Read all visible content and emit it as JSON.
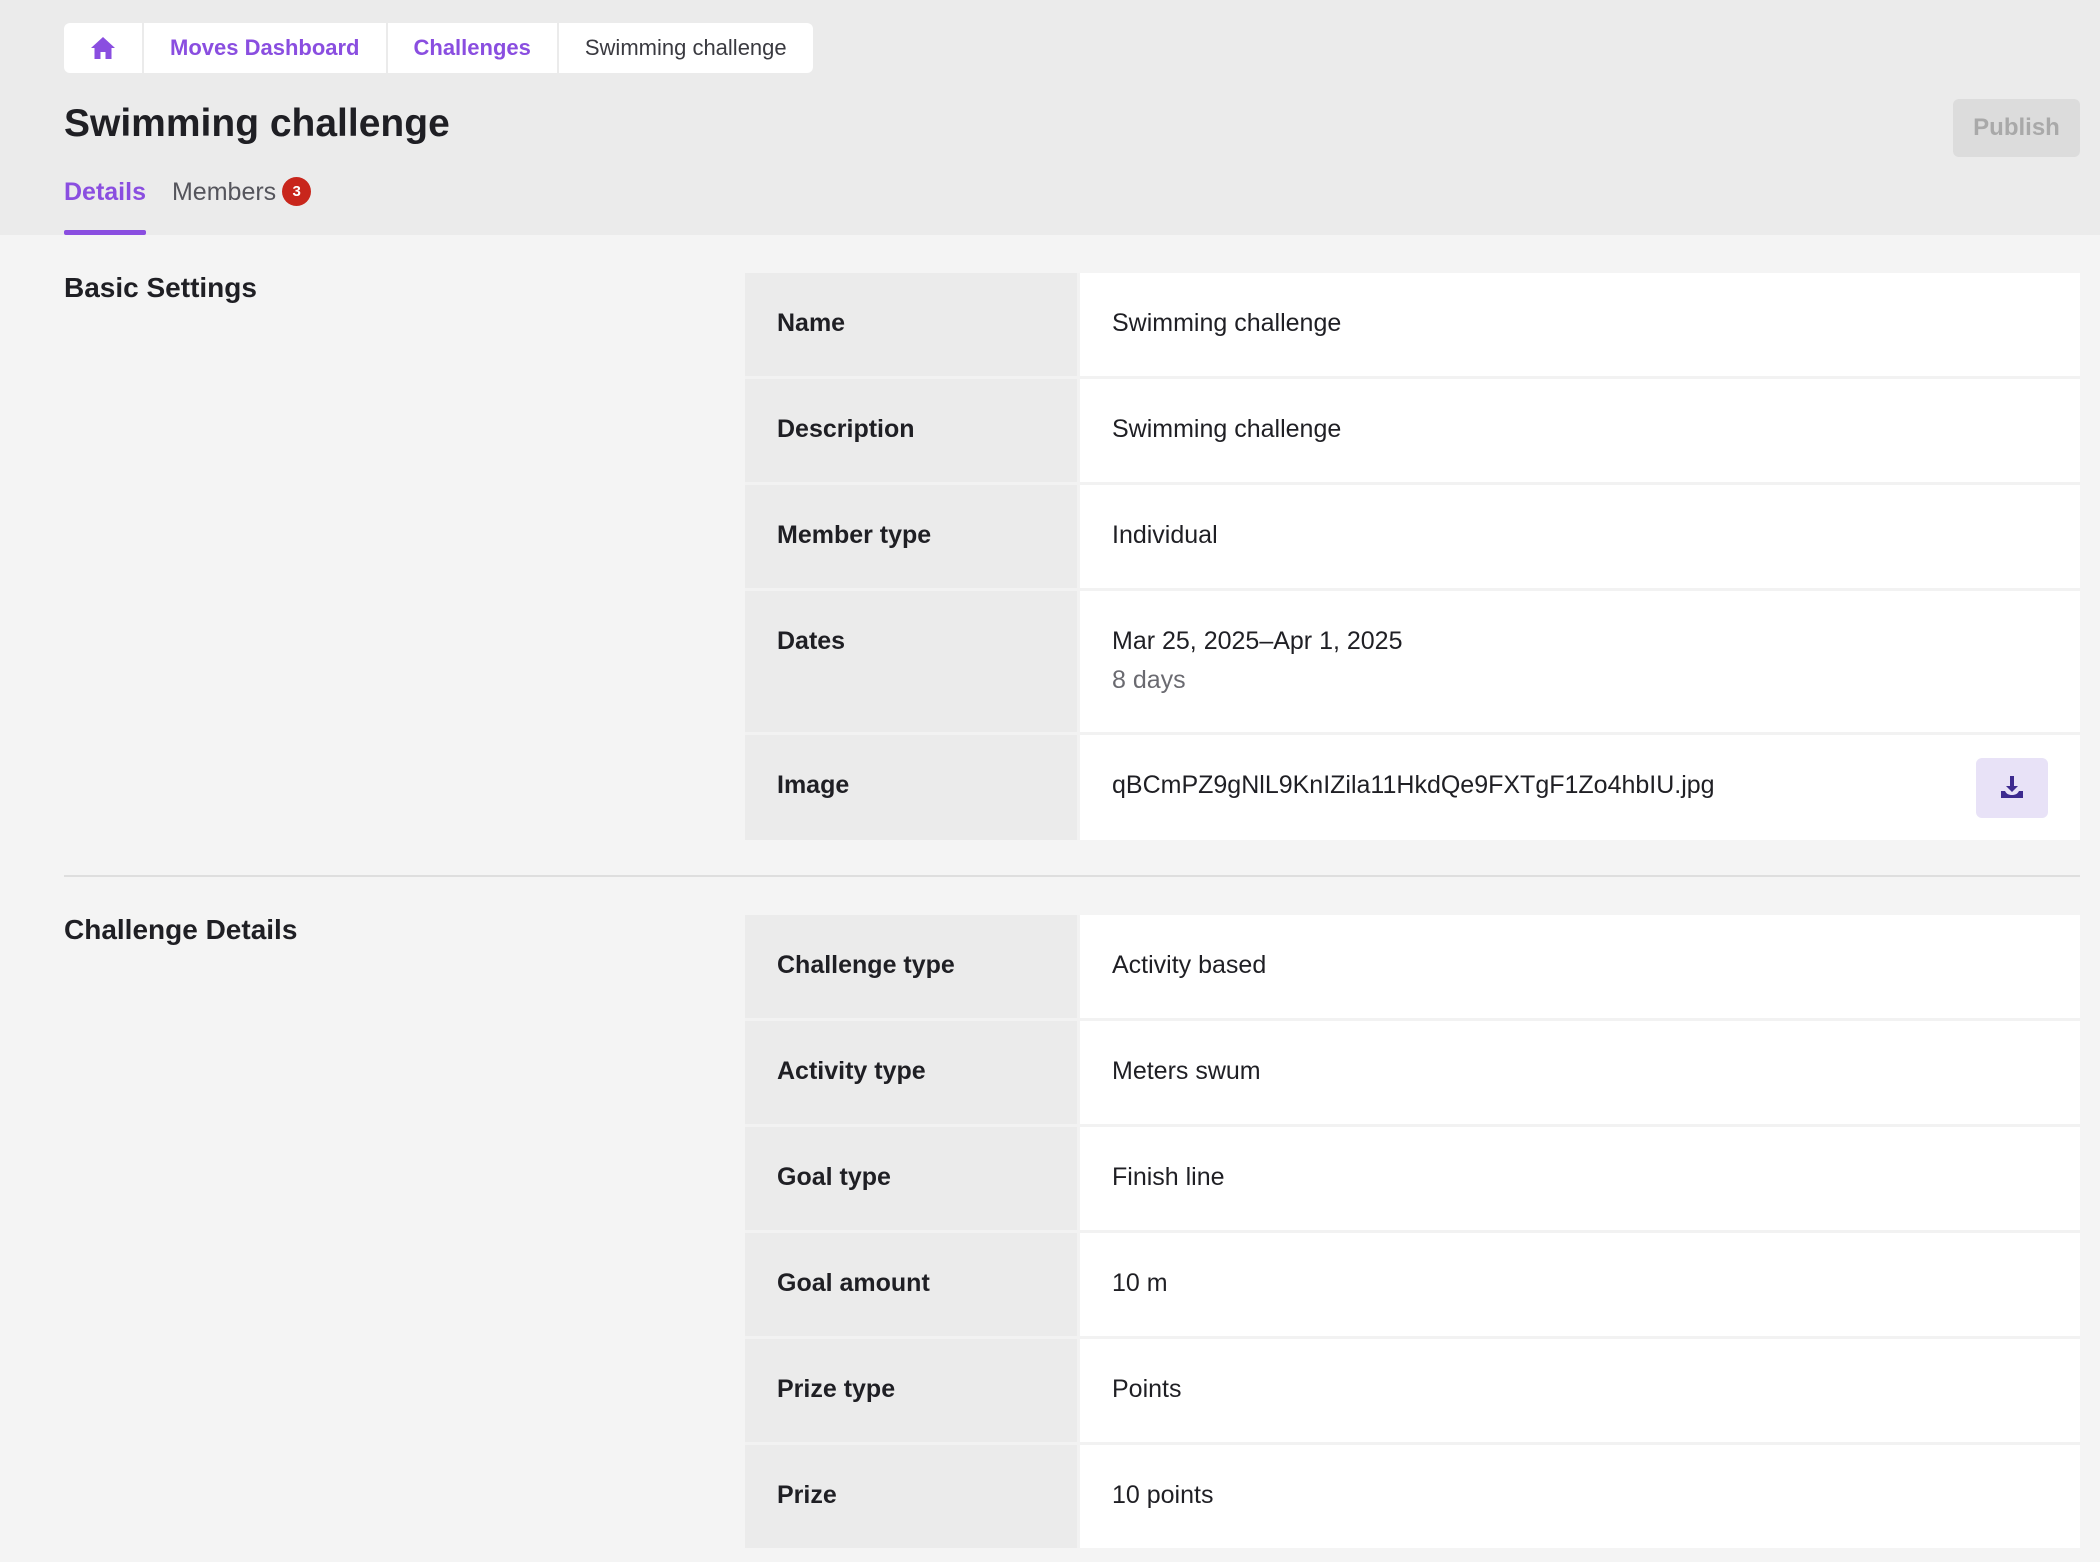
{
  "breadcrumb": {
    "home_icon": "home-icon",
    "items": [
      "Moves Dashboard",
      "Challenges"
    ],
    "current": "Swimming challenge"
  },
  "page": {
    "title": "Swimming challenge",
    "publish_label": "Publish"
  },
  "tabs": {
    "details": "Details",
    "members": "Members",
    "members_count": "3"
  },
  "basic_settings": {
    "title": "Basic Settings",
    "rows": [
      {
        "label": "Name",
        "value": "Swimming challenge"
      },
      {
        "label": "Description",
        "value": "Swimming challenge"
      },
      {
        "label": "Member type",
        "value": "Individual"
      },
      {
        "label": "Dates",
        "value": "Mar 25, 2025–Apr 1, 2025",
        "sub": "8 days"
      },
      {
        "label": "Image",
        "value": "qBCmPZ9gNlL9KnIZila11HkdQe9FXTgF1Zo4hbIU.jpg",
        "action_icon": "download-icon"
      }
    ]
  },
  "challenge_details": {
    "title": "Challenge Details",
    "rows": [
      {
        "label": "Challenge type",
        "value": "Activity based"
      },
      {
        "label": "Activity type",
        "value": "Meters swum"
      },
      {
        "label": "Goal type",
        "value": "Finish line"
      },
      {
        "label": "Goal amount",
        "value": "10 m"
      },
      {
        "label": "Prize type",
        "value": "Points"
      },
      {
        "label": "Prize",
        "value": "10 points"
      }
    ]
  },
  "colors": {
    "accent": "#8a4ee0",
    "badge": "#c8261c",
    "header_bg": "#ebebeb",
    "page_bg": "#f4f4f4"
  }
}
